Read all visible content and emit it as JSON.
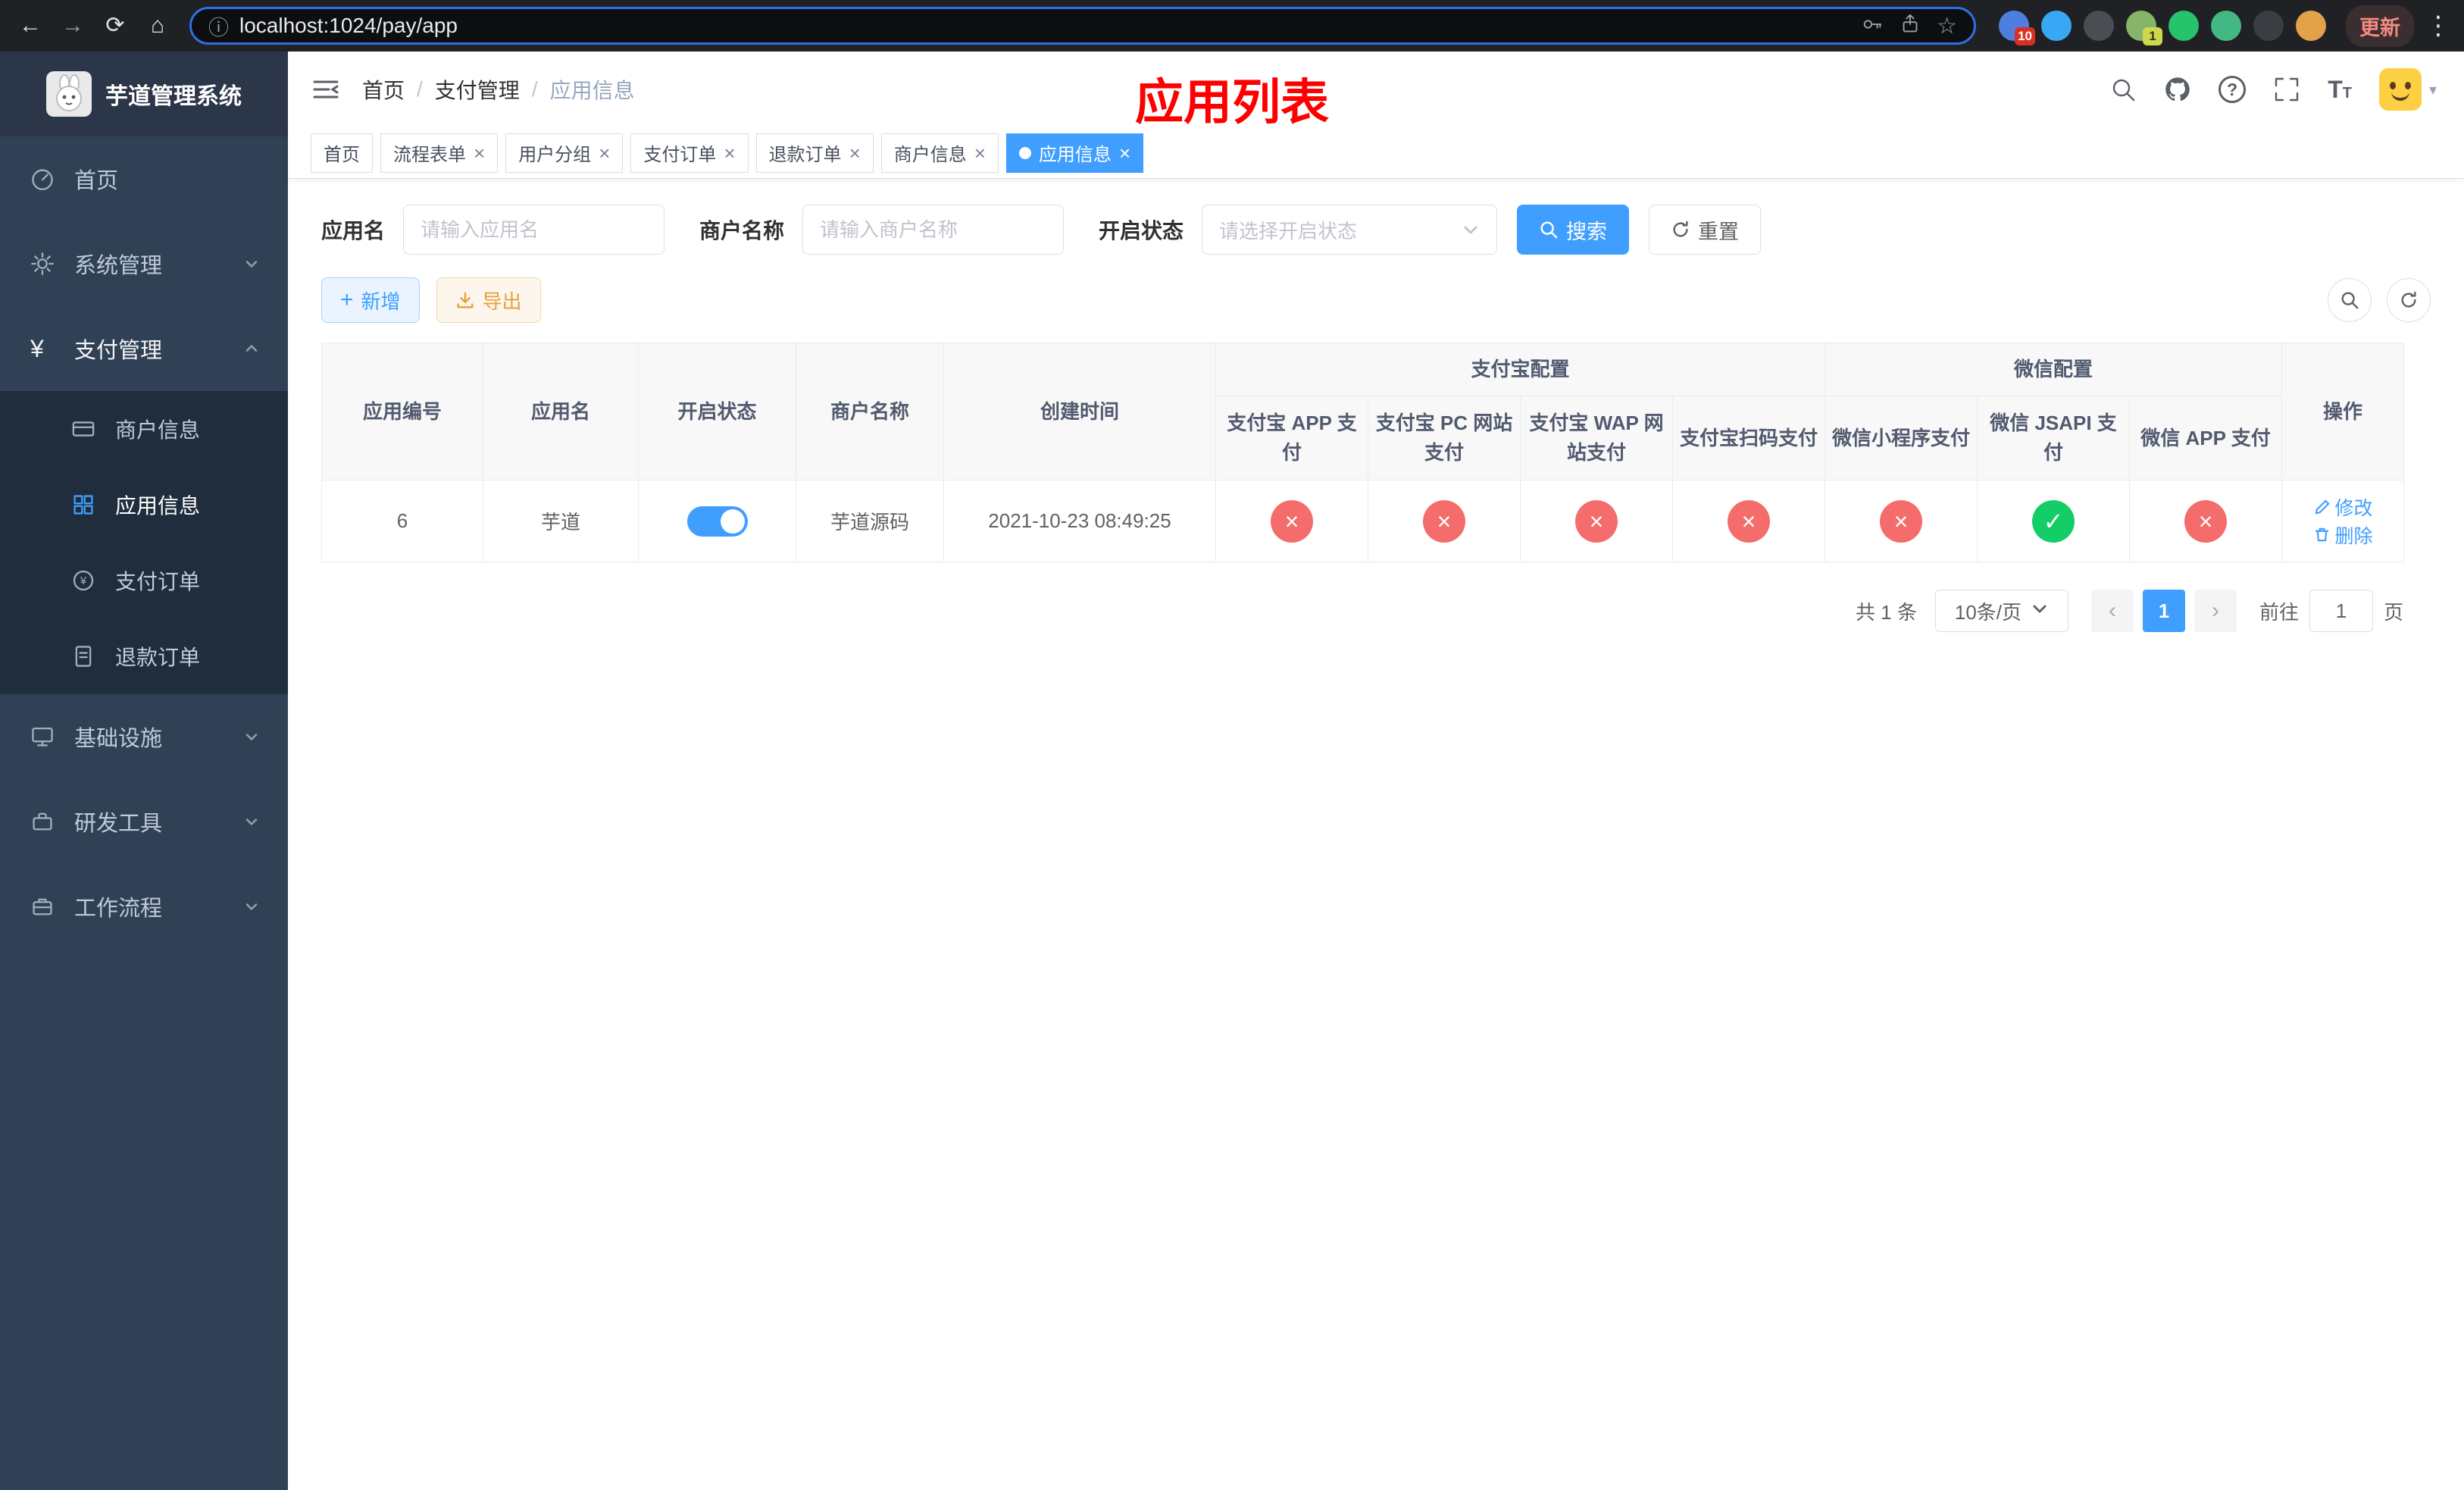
{
  "colors": {
    "primary": "#409eff",
    "danger": "#f56c6c",
    "success": "#13ce66",
    "warning": "#e6a23c",
    "annotation": "#ff0000"
  },
  "browser": {
    "url": "localhost:1024/pay/app",
    "update_label": "更新",
    "extensions": [
      {
        "name": "extension-blue-badge",
        "color": "#4e7fe0",
        "badge": "10",
        "badge_bg": "#d93025",
        "badge_fg": "#ffffff"
      },
      {
        "name": "extension-blue-drop",
        "color": "#38a8f5"
      },
      {
        "name": "extension-dark-circle",
        "color": "#4a4d52"
      },
      {
        "name": "extension-green-avatar",
        "color": "#86b56a",
        "badge": "1",
        "badge_bg": "#cdd94a",
        "badge_fg": "#333333"
      },
      {
        "name": "extension-green-check",
        "color": "#27c26c"
      },
      {
        "name": "extension-green-chat",
        "color": "#43b883"
      },
      {
        "name": "extension-dark-puzzle",
        "color": "#3a3d42"
      },
      {
        "name": "extension-face",
        "color": "#e2a24a"
      }
    ]
  },
  "sidebar": {
    "logo_title": "芋道管理系统",
    "items": [
      {
        "label": "首页",
        "icon": "dashboard-icon"
      },
      {
        "label": "系统管理",
        "icon": "gear-icon",
        "arrow": "down"
      },
      {
        "label": "支付管理",
        "icon": "yen-icon",
        "arrow": "up",
        "expanded": true,
        "children": [
          {
            "label": "商户信息",
            "icon": "bankcard-icon"
          },
          {
            "label": "应用信息",
            "icon": "grid-icon",
            "active": true
          },
          {
            "label": "支付订单",
            "icon": "pay-order-icon"
          },
          {
            "label": "退款订单",
            "icon": "refund-order-icon"
          }
        ]
      },
      {
        "label": "基础设施",
        "icon": "monitor-icon",
        "arrow": "down"
      },
      {
        "label": "研发工具",
        "icon": "toolbox-icon",
        "arrow": "down"
      },
      {
        "label": "工作流程",
        "icon": "workflow-icon",
        "arrow": "down"
      }
    ]
  },
  "header": {
    "breadcrumb": [
      "首页",
      "支付管理",
      "应用信息"
    ],
    "separator": "/",
    "overlay_title": "应用列表"
  },
  "tabs": [
    {
      "label": "首页",
      "closable": false,
      "active": false
    },
    {
      "label": "流程表单",
      "closable": true,
      "active": false
    },
    {
      "label": "用户分组",
      "closable": true,
      "active": false
    },
    {
      "label": "支付订单",
      "closable": true,
      "active": false
    },
    {
      "label": "退款订单",
      "closable": true,
      "active": false
    },
    {
      "label": "商户信息",
      "closable": true,
      "active": false
    },
    {
      "label": "应用信息",
      "closable": true,
      "active": true
    }
  ],
  "filters": {
    "app_name_label": "应用名",
    "app_name_placeholder": "请输入应用名",
    "merchant_label": "商户名称",
    "merchant_placeholder": "请输入商户名称",
    "status_label": "开启状态",
    "status_placeholder": "请选择开启状态",
    "search_label": "搜索",
    "reset_label": "重置"
  },
  "toolbar": {
    "add_label": "新增",
    "export_label": "导出"
  },
  "table": {
    "group_alipay": "支付宝配置",
    "group_wechat": "微信配置",
    "columns": [
      "应用编号",
      "应用名",
      "开启状态",
      "商户名称",
      "创建时间",
      "支付宝 APP 支付",
      "支付宝 PC 网站支付",
      "支付宝 WAP 网站支付",
      "支付宝扫码支付",
      "微信小程序支付",
      "微信 JSAPI 支付",
      "微信 APP 支付",
      "操作"
    ],
    "op": {
      "edit": "修改",
      "delete": "删除"
    },
    "rows": [
      {
        "id": "6",
        "name": "芋道",
        "enabled": true,
        "merchant": "芋道源码",
        "created": "2021-10-23 08:49:25",
        "pay_status": [
          false,
          false,
          false,
          false,
          false,
          true,
          false
        ]
      }
    ]
  },
  "pagination": {
    "total": "共 1 条",
    "page_size": "10条/页",
    "page": "1",
    "goto_label": "前往",
    "goto_value": "1",
    "unit_label": "页"
  }
}
